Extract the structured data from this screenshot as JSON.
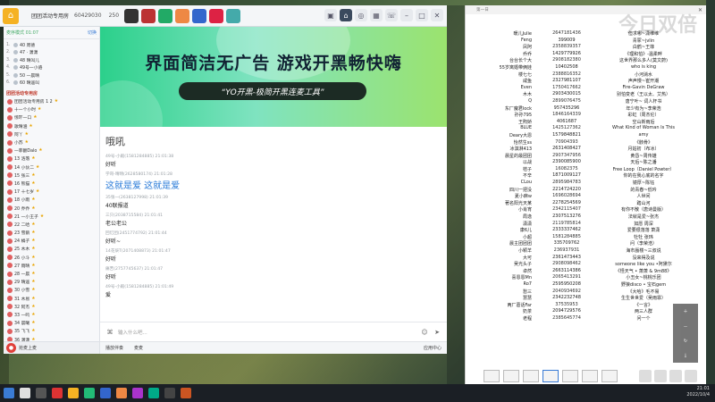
{
  "top_bar": {
    "title": "团团活动专用房",
    "room_id": "60429030",
    "online_count": "250",
    "tab_icons": [
      "home-icon",
      "gamepad-icon",
      "grid-icon",
      "phone-icon"
    ]
  },
  "member_panel": {
    "header_left": "麦序模式 01:07",
    "header_right": "切换",
    "rank_rows": [
      {
        "num": "1.",
        "name": "40 周德"
      },
      {
        "num": "2.",
        "name": "47 · 潇潇"
      },
      {
        "num": "3.",
        "name": "48 晴叫儿"
      },
      {
        "num": "4.",
        "name": "49号一小骆"
      },
      {
        "num": "5.",
        "name": "50 一晨晴"
      },
      {
        "num": "6.",
        "name": "60 晴遥叫"
      }
    ],
    "section_title": "团团活动专用房",
    "users": [
      {
        "name": "团团活动专用房 1 2"
      },
      {
        "name": "十一个小时"
      },
      {
        "name": "惊吓一口"
      },
      {
        "name": "歌晴涵"
      },
      {
        "name": "阿丫"
      },
      {
        "name": "小苏"
      },
      {
        "name": "一菲翻Dalo"
      },
      {
        "name": "13 洛落"
      },
      {
        "name": "14 小伙二"
      },
      {
        "name": "15 张三"
      },
      {
        "name": "16 熊猫"
      },
      {
        "name": "17 十七岁"
      },
      {
        "name": "18 小雨"
      },
      {
        "name": "20 乔乔"
      },
      {
        "name": "21 一小王子"
      },
      {
        "name": "22 二哈"
      },
      {
        "name": "23 雪鹅"
      },
      {
        "name": "24 橘子"
      },
      {
        "name": "25 木木"
      },
      {
        "name": "26 小斗"
      },
      {
        "name": "27 雨晴"
      },
      {
        "name": "28 一晨"
      },
      {
        "name": "29 晴遥"
      },
      {
        "name": "30 小雪"
      },
      {
        "name": "31 木易"
      },
      {
        "name": "32 阿杰"
      },
      {
        "name": "33 一鸣"
      },
      {
        "name": "34 晨曦"
      },
      {
        "name": "35 飞飞"
      },
      {
        "name": "36 潇潇"
      }
    ],
    "bottom_label": "抢麦上麦"
  },
  "banner": {
    "title": "界面简洁无广告 游戏开黑畅快嗨",
    "subtitle": "“YO开黑-极简开黑连麦工具”"
  },
  "chat": {
    "header": "哦吼",
    "messages": [
      {
        "meta": "49号-小殿(1581284885) 21:01:38",
        "body": "好听",
        "big": false
      },
      {
        "meta": "学哥-晴晴(2628580174) 21:01:28",
        "body": "这就是爱 这就是爱",
        "big": true
      },
      {
        "meta": "35张一(2638127998) 21:01:39",
        "body": "40联报道",
        "big": false
      },
      {
        "meta": "三只(2038715584) 21:01:41",
        "body": "老公老公",
        "big": false
      },
      {
        "meta": "回忆团(2451774792) 21:01:44",
        "body": "好听~",
        "big": false
      },
      {
        "meta": "14花柒T(2071408873) 21:01:47",
        "body": "好听",
        "big": false
      },
      {
        "meta": "痛苦(2757745637) 21:01:47",
        "body": "好听",
        "big": false
      },
      {
        "meta": "49号-小殿(1581284885) 21:01:49",
        "body": "爱",
        "big": false
      }
    ],
    "input_placeholder": "输入什么吧...",
    "bottom_left": "播放伴奏",
    "bottom_mid": "麦麦",
    "bottom_right": "应用中心"
  },
  "list_window": {
    "title": "第一日",
    "watermark": "今日双倍",
    "rows": [
      [
        "暖儿Julie",
        "2647181436",
        "但求哪~潇维维"
      ],
      [
        "Feng",
        "399009",
        "青冢~jvlin"
      ],
      [
        "凤阿",
        "2358839357",
        "白鹤~王菲"
      ],
      [
        "乔乔",
        "1429779926",
        "《理和怕》-温柔畔"
      ],
      [
        "台台长个大",
        "2908182380",
        "这世界那么多人(莫文蔚)"
      ],
      [
        "55岁离婚带俩娃",
        "10402508",
        "who is king"
      ],
      [
        "楼七七",
        "2388816352",
        "小河淌水"
      ],
      [
        "咸鱼",
        "2327981107",
        "声声慢~崔开潮"
      ],
      [
        "Even",
        "1750417662",
        "Fire-Gavin DeGraw"
      ],
      [
        "木木",
        "2903430015",
        "别怕变老（王以太、艾热）"
      ],
      [
        "Q",
        "2899076475",
        "唐宁叶~ 词人杆书"
      ],
      [
        "东厂魔君lock",
        "957435296",
        "年少有为~李荣浩"
      ],
      [
        "孙孙795",
        "1846164339",
        "彩虹（周杰伦）"
      ],
      [
        "王煦娇",
        "4061687",
        "空山新雨后"
      ],
      [
        "BLUE",
        "1425127362",
        "What Kind of Woman Is This"
      ],
      [
        "Deary大恩",
        "1579848821",
        "amy"
      ],
      [
        "怡然生ss",
        "70904393",
        "《骸骨》"
      ],
      [
        "冰淇淋413",
        "2631408427",
        "月姑初（布冰）"
      ],
      [
        "晨星的最团团",
        "2907347956",
        "黄昏~周传雄"
      ],
      [
        "以战",
        "2390085900",
        "天后~陈之潘"
      ],
      [
        "桔子",
        "16082375",
        "Free Loop（Daniel Powter）"
      ],
      [
        "不辛",
        "1871009127",
        "你的在我心底的名字"
      ],
      [
        "CLou",
        "2895984783",
        "镜厚~陈钰"
      ],
      [
        "四川一把没",
        "2214724220",
        "的青春~低吟"
      ],
      [
        "夏小麻w",
        "1696028694",
        "人世间"
      ],
      [
        "著名阳光天某",
        "2278254569",
        "踏山河"
      ],
      [
        "小肖宵",
        "2342115407",
        "有你不散（唐诗曼版）"
      ],
      [
        "局逸",
        "2307513276",
        "法就是爱~张杰"
      ],
      [
        "潇潇",
        "2119785814",
        "如愿 周深"
      ],
      [
        "康6儿",
        "2333337462",
        "爱要很落落 萧潇"
      ],
      [
        "小超",
        "1581284885",
        "牡牡 张玮"
      ],
      [
        "晨主团团团",
        "335709762",
        "问（李荣浩）"
      ],
      [
        "小颖羊",
        "236937931",
        "海市蜃楼~三叔说"
      ],
      [
        "大可",
        "2361473443",
        "没来得及说"
      ],
      [
        "吴光头子",
        "2908098462",
        "someone like you •阿黛尔"
      ],
      [
        "卓然",
        "2663114386",
        "《怪天气 • 萧萧 & 9m88》"
      ],
      [
        "喜恩恩Mn",
        "2065413291",
        "小丑女~桃桃乐团"
      ],
      [
        "Ro7",
        "2595950208",
        "野狼disco • 宝石gem"
      ],
      [
        "愁三",
        "2040934692",
        "《大哈》毛不易"
      ],
      [
        "慧慧",
        "2342232748",
        "生生世世爱（吴雨霏）"
      ],
      [
        "两厂葛话Far",
        "37535953",
        "《一言》"
      ],
      [
        "奶茶",
        "2094729576",
        "两三人群"
      ],
      [
        "老程",
        "2385645774",
        "问一个"
      ]
    ]
  },
  "taskbar": {
    "time": "21:01",
    "date": "2022/10/4"
  }
}
